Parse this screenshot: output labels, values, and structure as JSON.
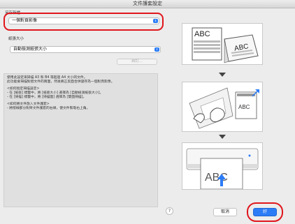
{
  "window": {
    "title": "文件護套設定"
  },
  "save_as": {
    "label": "另存新檔",
    "value": "一個對頁影像"
  },
  "paper_size": {
    "label": "紙張大小",
    "value": "自動檢測紙張大小",
    "custom_button": "自訂..."
  },
  "info": {
    "intro": [
      "使用此設定來掃描 A3 和 B4 等超過 A4 大小的文件。",
      "此功能會掃描對摺文件的兩面，然後將正反面合併儲存為一個對頁影像。"
    ],
    "paper_size_heading": "<如何指定掃描設定>",
    "paper_size_lines": [
      "- 在 [紙張] 標籤中，將 [紙張大小] 選擇為 [自動檢測紙張大小]。",
      "- 在 [掃描] 標籤中，將 [掃描面] 選擇為 [雙面掃描]。"
    ],
    "load_heading": "<如何將文件放入文件護套>",
    "load_lines": [
      "- 將摺線部分對齊文件護套的右緣，使文件緊靠右上角。"
    ]
  },
  "illustration": {
    "doc_text": "ABC"
  },
  "footer": {
    "help": "?",
    "cancel": "取消",
    "ok": "好"
  },
  "colors": {
    "accent": "#2c7cf6",
    "highlight": "#e0161c"
  }
}
